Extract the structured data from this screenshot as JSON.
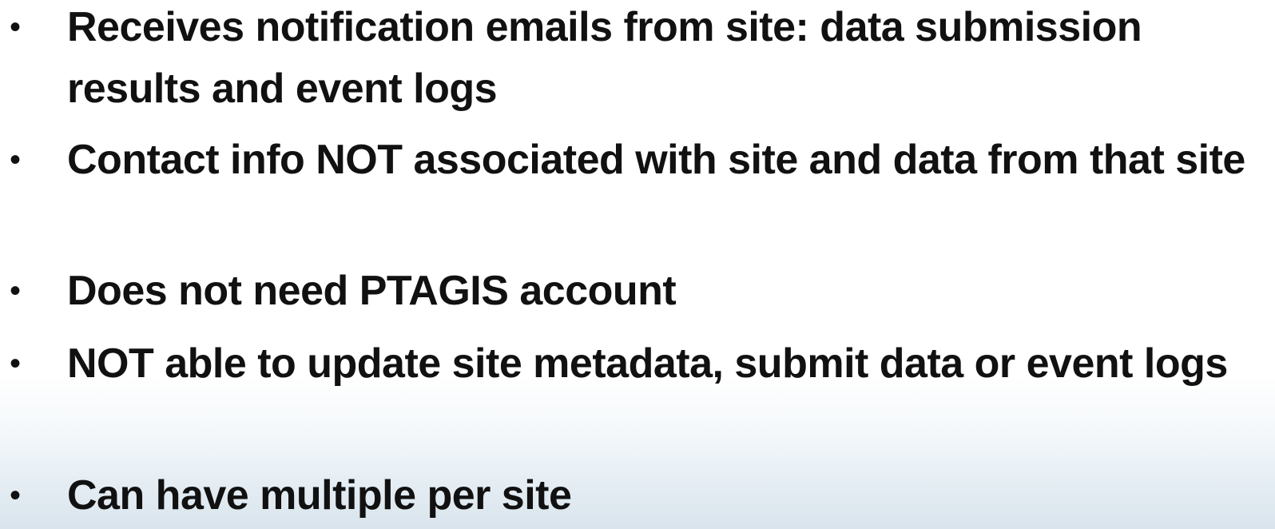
{
  "slide": {
    "bullets": [
      {
        "text": "Receives notification emails from site: data submission results and event logs"
      },
      {
        "text": "Contact info NOT associated with site and data from that site"
      },
      {
        "text": "Does not need PTAGIS account"
      },
      {
        "text": "NOT able to update site metadata, submit data or event logs"
      },
      {
        "text": "Can have multiple per site"
      }
    ],
    "bullet_symbol": "•"
  }
}
